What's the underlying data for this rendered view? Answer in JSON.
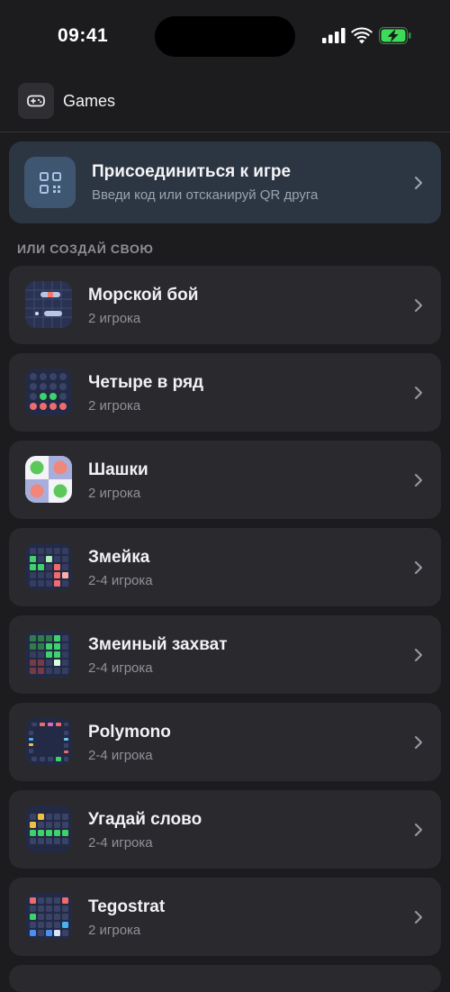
{
  "status": {
    "time": "09:41",
    "signal_icon": "cellular-signal-icon",
    "wifi_icon": "wifi-icon",
    "battery_icon": "battery-charging-icon"
  },
  "header": {
    "icon": "gamepad-icon",
    "title": "Games"
  },
  "join": {
    "icon": "qr-code-icon",
    "title": "Присоединиться к игре",
    "subtitle": "Введи код или отсканируй QR друга"
  },
  "section_label": "ИЛИ СОЗДАЙ СВОЮ",
  "games": [
    {
      "name": "Морской бой",
      "players": "2 игрока",
      "icon": "battleship-icon"
    },
    {
      "name": "Четыре в ряд",
      "players": "2 игрока",
      "icon": "connect-four-icon"
    },
    {
      "name": "Шашки",
      "players": "2 игрока",
      "icon": "checkers-icon"
    },
    {
      "name": "Змейка",
      "players": "2-4 игрока",
      "icon": "snake-icon"
    },
    {
      "name": "Змеиный захват",
      "players": "2-4 игрока",
      "icon": "snake-capture-icon"
    },
    {
      "name": "Polymono",
      "players": "2-4 игрока",
      "icon": "polymono-icon"
    },
    {
      "name": "Угадай слово",
      "players": "2-4 игрока",
      "icon": "word-guess-icon"
    },
    {
      "name": "Tegostrat",
      "players": "2 игрока",
      "icon": "tegostrat-icon"
    }
  ],
  "colors": {
    "background": "#1c1c1f",
    "card": "#2a2a2e",
    "join_card": "#2c3542",
    "accent_green": "#39d353",
    "accent_red": "#f06b6b",
    "battery_green": "#3ddc57"
  }
}
